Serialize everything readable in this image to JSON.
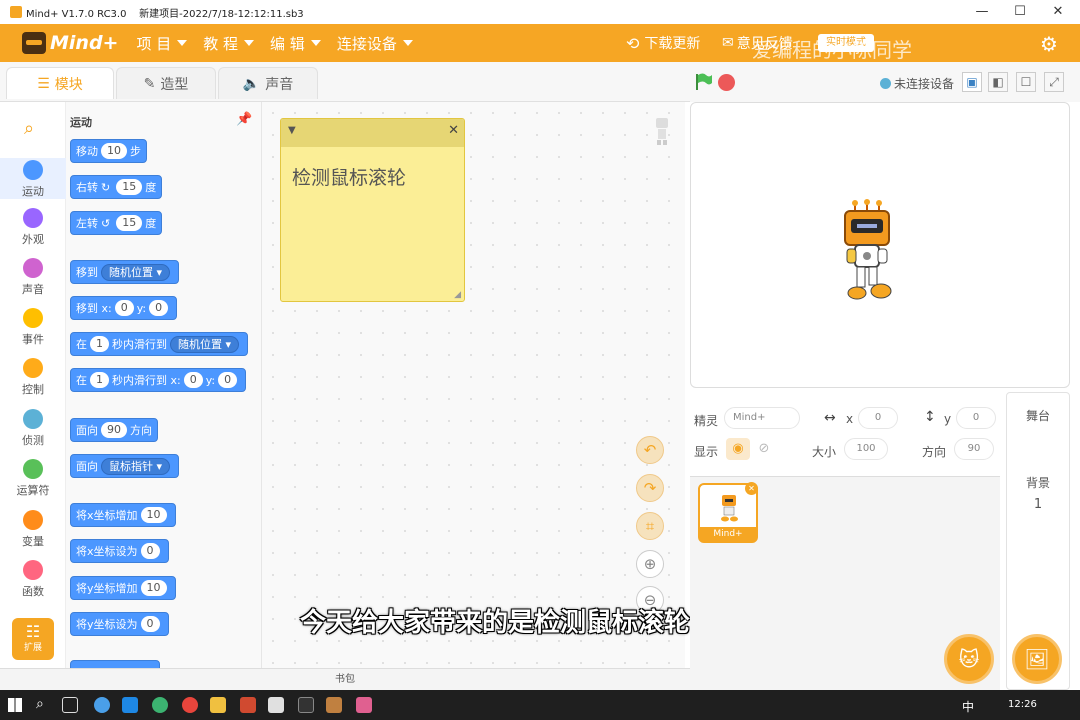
{
  "titlebar": {
    "title": "Mind+ V1.7.0 RC3.0    新建项目-2022/7/18-12:12:11.sb3",
    "minimize": "—",
    "maximize": "☐",
    "close": "✕"
  },
  "menubar": {
    "logo": "Mind+",
    "items": [
      "项 目",
      "教 程",
      "编 辑",
      "连接设备"
    ],
    "update": "下载更新",
    "feedback": "意见反馈",
    "mode_btn": "实时模式",
    "watermark": "爱编程的小陈同学"
  },
  "tabs": [
    {
      "label": "模块",
      "icon": "blocks-icon"
    },
    {
      "label": "造型",
      "icon": "brush-icon"
    },
    {
      "label": "声音",
      "icon": "speaker-icon"
    }
  ],
  "stagebar": {
    "device_status": "未连接设备"
  },
  "categories": [
    {
      "label": "运动",
      "color": "#4c97ff"
    },
    {
      "label": "外观",
      "color": "#9966ff"
    },
    {
      "label": "声音",
      "color": "#cf63cf"
    },
    {
      "label": "事件",
      "color": "#ffbf00"
    },
    {
      "label": "控制",
      "color": "#ffab19"
    },
    {
      "label": "侦测",
      "color": "#5cb1d6"
    },
    {
      "label": "运算符",
      "color": "#59c059"
    },
    {
      "label": "变量",
      "color": "#ff8c1a"
    },
    {
      "label": "函数",
      "color": "#ff6680"
    }
  ],
  "extension_label": "扩展",
  "palette": {
    "heading": "运动",
    "blocks": {
      "move": {
        "a": "移动",
        "n": "10",
        "b": "步"
      },
      "turn_right": {
        "a": "右转",
        "n": "15",
        "b": "度"
      },
      "turn_left": {
        "a": "左转",
        "n": "15",
        "b": "度"
      },
      "goto": {
        "a": "移到",
        "dd": "随机位置"
      },
      "goto_xy": {
        "a": "移到 x:",
        "x": "0",
        "b": "y:",
        "y": "0"
      },
      "glide_to": {
        "a": "在",
        "n": "1",
        "b": "秒内滑行到",
        "dd": "随机位置"
      },
      "glide_xy": {
        "a": "在",
        "n": "1",
        "b": "秒内滑行到 x:",
        "x": "0",
        "c": "y:",
        "y": "0"
      },
      "point_dir": {
        "a": "面向",
        "n": "90",
        "b": "方向"
      },
      "point_towards": {
        "a": "面向",
        "dd": "鼠标指针"
      },
      "change_x": {
        "a": "将x坐标增加",
        "n": "10"
      },
      "set_x": {
        "a": "将x坐标设为",
        "n": "0"
      },
      "change_y": {
        "a": "将y坐标增加",
        "n": "10"
      },
      "set_y": {
        "a": "将y坐标设为",
        "n": "0"
      }
    }
  },
  "note": {
    "text": "检测鼠标滚轮",
    "close": "✕"
  },
  "subtitle": "今天给大家带来的是检测鼠标滚轮",
  "bag_label": "书包",
  "sprite_info": {
    "sprite_label": "精灵",
    "sprite_name": "Mind+",
    "x_label": "x",
    "x": "0",
    "y_label": "y",
    "y": "0",
    "show_label": "显示",
    "size_label": "大小",
    "size": "100",
    "dir_label": "方向",
    "dir": "90"
  },
  "sprite_thumb_label": "Mind+",
  "stage_panel": {
    "title": "舞台",
    "backdrop_label": "背景",
    "backdrop_count": "1"
  },
  "taskbar": {
    "time": "12:26",
    "ime": "中"
  }
}
